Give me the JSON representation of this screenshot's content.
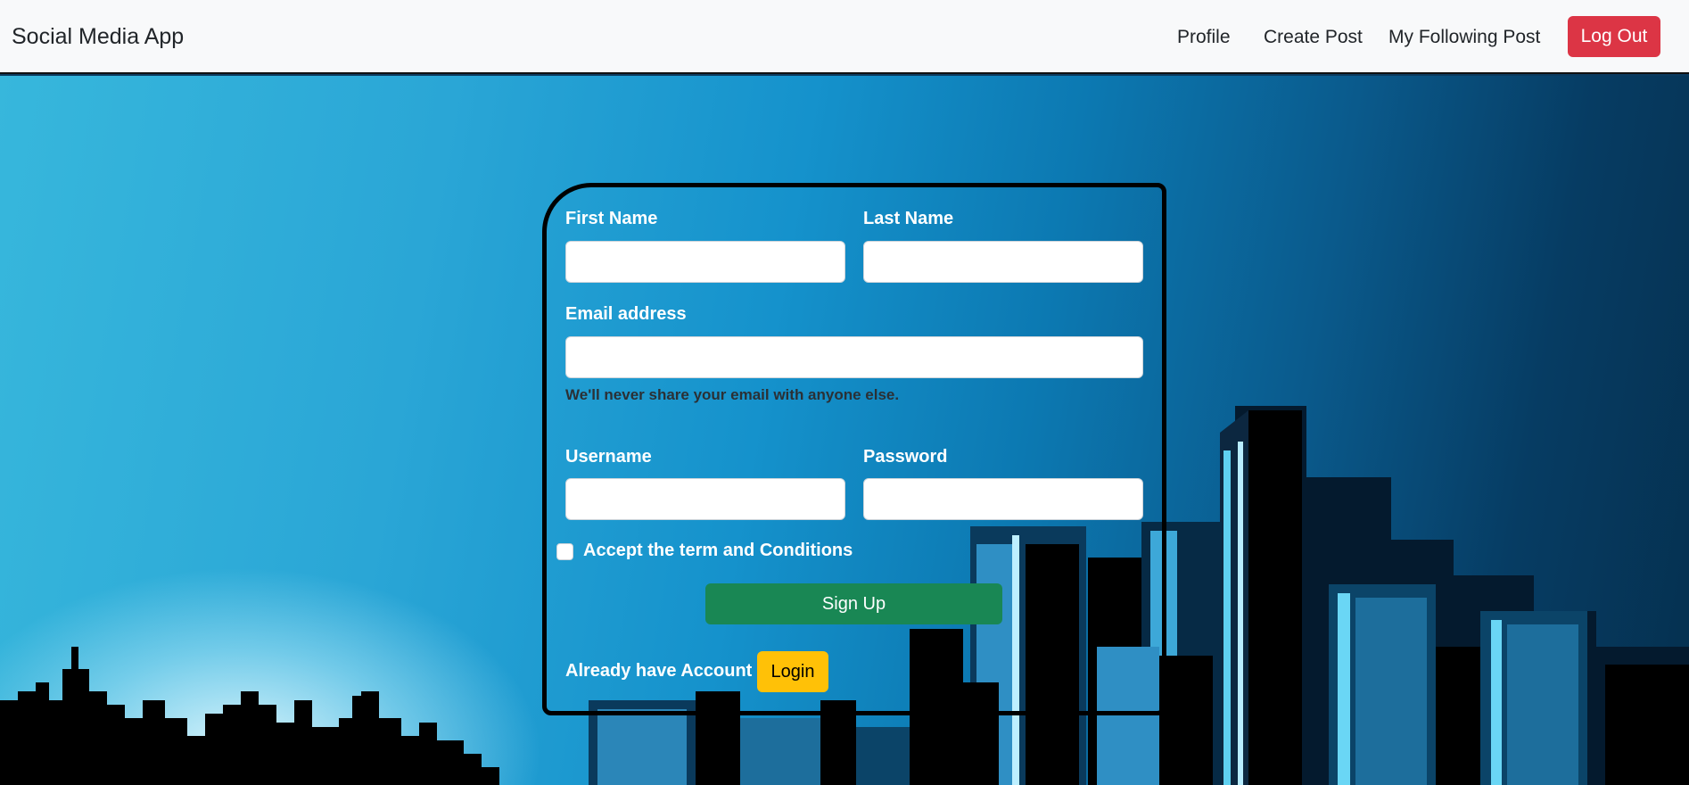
{
  "navbar": {
    "brand": "Social Media App",
    "links": [
      "Profile",
      "Create Post",
      "My Following Post"
    ],
    "logout_label": "Log Out"
  },
  "form": {
    "first_name": {
      "label": "First Name",
      "value": ""
    },
    "last_name": {
      "label": "Last Name",
      "value": ""
    },
    "email": {
      "label": "Email address",
      "value": "",
      "help": "We'll never share your email with anyone else."
    },
    "username": {
      "label": "Username",
      "value": ""
    },
    "password": {
      "label": "Password",
      "value": ""
    },
    "terms": {
      "label": "Accept the term and Conditions",
      "checked": false
    },
    "signup_label": "Sign Up",
    "already_text": "Already have Account",
    "login_label": "Login"
  },
  "colors": {
    "logout": "#dc3545",
    "signup": "#198754",
    "login": "#ffc107",
    "navbar_bg": "#f8f9fa"
  }
}
